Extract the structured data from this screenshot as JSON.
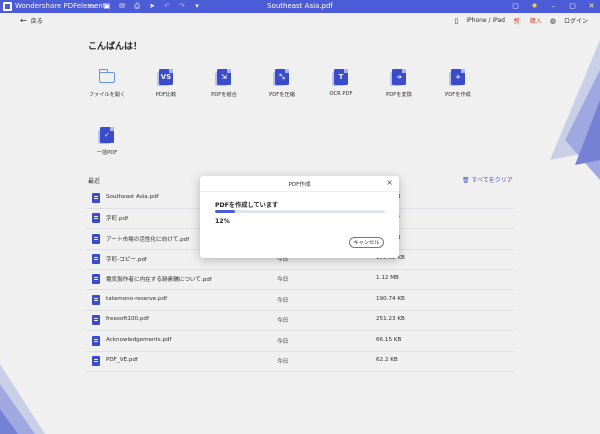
{
  "window": {
    "app_name": "Wondershare PDFelement",
    "document_title": "Southeast Asia.pdf",
    "toolbar_icons": [
      "folder-icon",
      "save-icon",
      "mail-icon",
      "print-icon",
      "share-icon",
      "undo-icon",
      "redo-icon",
      "dropdown-icon"
    ],
    "controls": [
      "feedback-icon",
      "brightness-icon",
      "minimize-icon",
      "restore-icon",
      "close-icon"
    ]
  },
  "topbar": {
    "back_label": "戻る",
    "device_label": "iPhone / iPad",
    "buy_label": "購入",
    "login_label": "ログイン"
  },
  "greeting": "こんばんは！",
  "tools": [
    {
      "label": "ファイルを開く",
      "icon": "open-folder-icon"
    },
    {
      "label": "PDF比較",
      "icon": "compare-icon"
    },
    {
      "label": "PDFを結合",
      "icon": "combine-icon"
    },
    {
      "label": "PDFを圧縮",
      "icon": "compress-icon"
    },
    {
      "label": "OCR PDF",
      "icon": "ocr-icon"
    },
    {
      "label": "PDFを変換",
      "icon": "convert-icon"
    },
    {
      "label": "PDFを作成",
      "icon": "create-icon"
    },
    {
      "label": "一括PDF",
      "icon": "batch-icon"
    }
  ],
  "recent": {
    "label": "最近",
    "clear_label": "すべてをクリア",
    "files": [
      {
        "name": "Southeast Asia.pdf",
        "date": "",
        "size": "KB"
      },
      {
        "name": "字町.pdf",
        "date": "",
        "size": "B"
      },
      {
        "name": "アート市場の活性化に向けて.pdf",
        "date": "",
        "size": "KB"
      },
      {
        "name": "字町-コピー.pdf",
        "date": "今日",
        "size": "309.08 KB"
      },
      {
        "name": "電気製作者に内在する跡素輔について.pdf",
        "date": "今日",
        "size": "1.12 MB"
      },
      {
        "name": "tatemono-reserve.pdf",
        "date": "今日",
        "size": "190.74 KB"
      },
      {
        "name": "freesoft100.pdf",
        "date": "今日",
        "size": "251.23 KB"
      },
      {
        "name": "Acknowledgements.pdf",
        "date": "今日",
        "size": "66.15 KB"
      },
      {
        "name": "PDF_VE.pdf",
        "date": "今日",
        "size": "62.2 KB"
      }
    ]
  },
  "dialog": {
    "title": "PDF作成",
    "message": "PDFを作成しています",
    "progress": 0.12,
    "progress_text": "12%",
    "cancel_label": "キャンセル"
  },
  "colors": {
    "accent": "#4c5bd6",
    "buy": "#e0553b"
  }
}
